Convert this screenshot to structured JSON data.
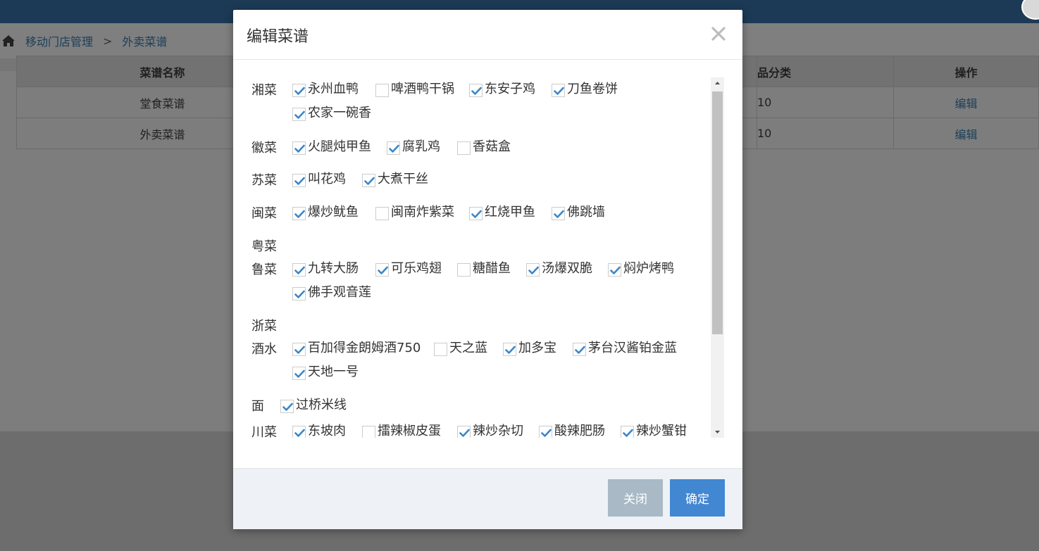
{
  "breadcrumb": {
    "items": [
      "移动门店管理",
      "外卖菜谱"
    ],
    "separator": ">"
  },
  "table": {
    "headers": [
      "菜谱名称",
      "",
      "品分类",
      "操作"
    ],
    "rows": [
      {
        "name": "堂食菜谱",
        "count": "10",
        "action": "编辑"
      },
      {
        "name": "外卖菜谱",
        "count": "10",
        "action": "编辑"
      }
    ]
  },
  "modal": {
    "title": "编辑菜谱",
    "categories": [
      {
        "label": "湘菜",
        "dishes": [
          {
            "name": "永州血鸭",
            "checked": true
          },
          {
            "name": "啤酒鸭干锅",
            "checked": false
          },
          {
            "name": "东安子鸡",
            "checked": true
          },
          {
            "name": "刀鱼卷饼",
            "checked": true
          },
          {
            "name": "农家一碗香",
            "checked": true
          }
        ]
      },
      {
        "label": "徽菜",
        "dishes": [
          {
            "name": "火腿炖甲鱼",
            "checked": true
          },
          {
            "name": "腐乳鸡",
            "checked": true
          },
          {
            "name": "香菇盒",
            "checked": false
          }
        ]
      },
      {
        "label": "苏菜",
        "dishes": [
          {
            "name": "叫花鸡",
            "checked": true
          },
          {
            "name": "大煮干丝",
            "checked": true
          }
        ]
      },
      {
        "label": "闽菜",
        "dishes": [
          {
            "name": "爆炒鱿鱼",
            "checked": true
          },
          {
            "name": "闽南炸紫菜",
            "checked": false
          },
          {
            "name": "红烧甲鱼",
            "checked": true
          },
          {
            "name": "佛跳墙",
            "checked": true
          }
        ]
      },
      {
        "label": "粤菜",
        "dishes": []
      },
      {
        "label": "鲁菜",
        "dishes": [
          {
            "name": "九转大肠",
            "checked": true
          },
          {
            "name": "可乐鸡翅",
            "checked": true
          },
          {
            "name": "糖醋鱼",
            "checked": false
          },
          {
            "name": "汤爆双脆",
            "checked": true
          },
          {
            "name": "焖炉烤鸭",
            "checked": true
          },
          {
            "name": "佛手观音莲",
            "checked": true
          }
        ]
      },
      {
        "label": "浙菜",
        "dishes": []
      },
      {
        "label": "酒水",
        "dishes": [
          {
            "name": "百加得金朗姆酒750",
            "checked": true
          },
          {
            "name": "天之蓝",
            "checked": false
          },
          {
            "name": "加多宝",
            "checked": true
          },
          {
            "name": "茅台汉酱铂金蓝",
            "checked": true
          },
          {
            "name": "天地一号",
            "checked": true
          }
        ]
      },
      {
        "label": "面",
        "dishes": [
          {
            "name": "过桥米线",
            "checked": true
          }
        ]
      },
      {
        "label": "川菜",
        "dishes": [
          {
            "name": "东坡肉",
            "checked": true
          },
          {
            "name": "擂辣椒皮蛋",
            "checked": false
          },
          {
            "name": "辣炒杂切",
            "checked": true
          },
          {
            "name": "酸辣肥肠",
            "checked": true
          },
          {
            "name": "辣炒蟹钳",
            "checked": true
          }
        ]
      }
    ],
    "buttons": {
      "close": "关闭",
      "ok": "确定"
    }
  },
  "colors": {
    "checkmark": "#3b86c8",
    "primary": "#4287d1",
    "secondary": "#a9bac6"
  }
}
